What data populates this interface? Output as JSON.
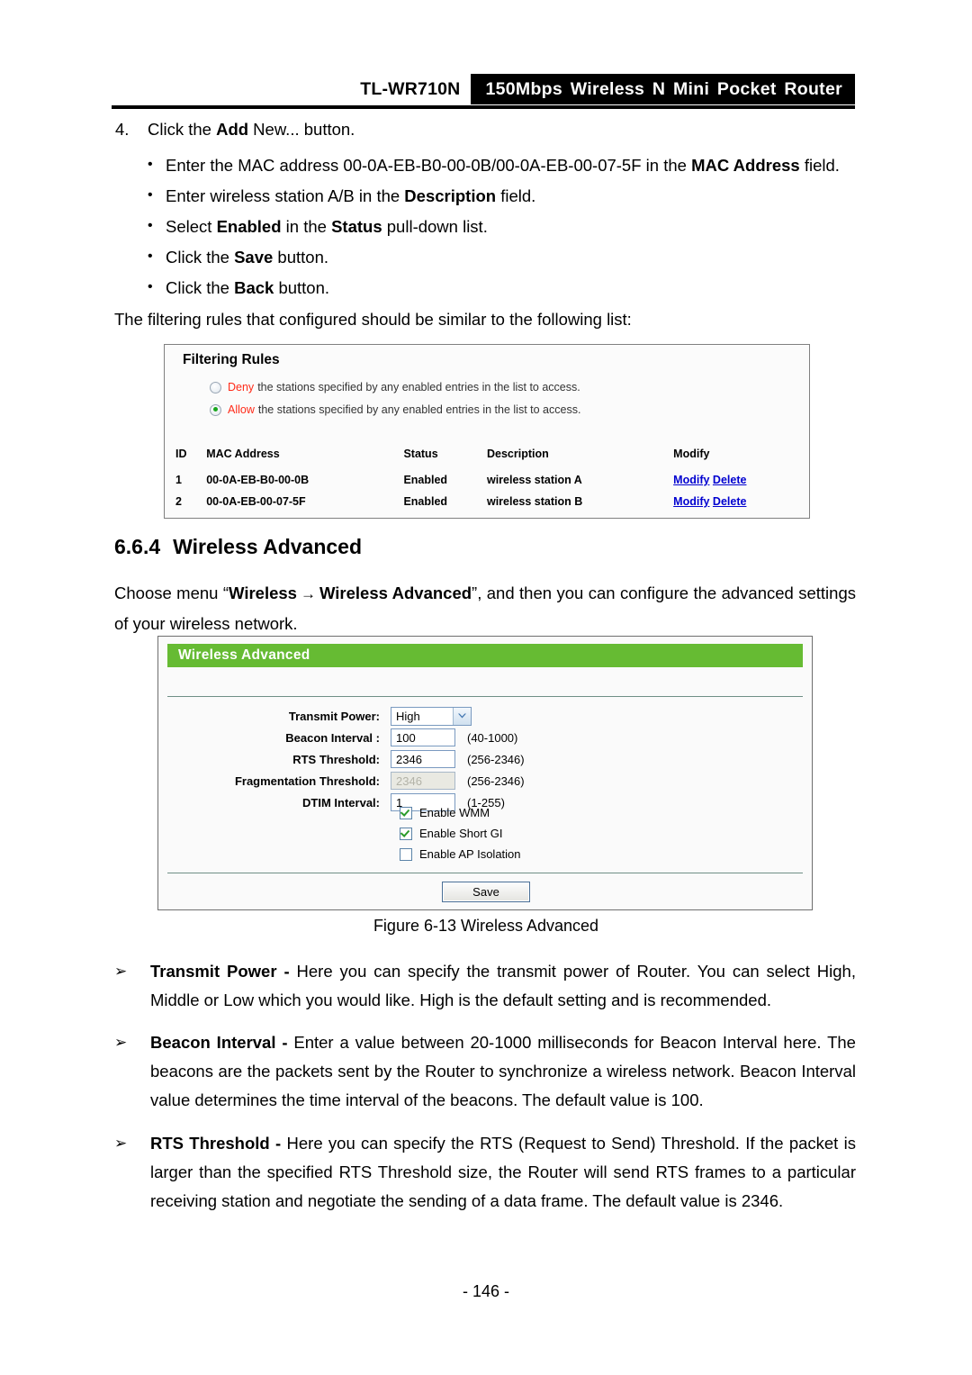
{
  "header": {
    "model": "TL-WR710N",
    "product": "150Mbps Wireless N Mini Pocket Router"
  },
  "step": {
    "number": "4.",
    "text_before": "Click the ",
    "bold1": "Add",
    "text_mid": " New... ",
    "text_after": "button.",
    "full": "4.\tClick the Add New... button."
  },
  "bullets": [
    {
      "pre": "Enter the MAC address ",
      "value": "00-0A-EB-B0-00-0B/00-0A-EB-00-07-5F",
      "mid": " in the ",
      "bold": "MAC Address",
      "post": " field."
    },
    {
      "pre": "Enter wireless station A/B in the ",
      "value": "",
      "mid": "",
      "bold": "Description",
      "post": " field."
    },
    {
      "pre": "Select ",
      "value": "",
      "mid": "",
      "bold": "Enabled",
      "post": " in the ",
      "bold2": "Status",
      "post2": " pull-down list."
    },
    {
      "pre": "Click the ",
      "bold": "Save",
      "post": " button."
    },
    {
      "pre": "Click the ",
      "bold": "Back",
      "post": " button."
    }
  ],
  "intro_paragraph": "The filtering rules that configured should be similar to the following list:",
  "filtering_rules": {
    "title": "Filtering Rules",
    "options": [
      {
        "keyword": "Deny",
        "text": "the stations specified by any enabled entries in the list to access.",
        "selected": false
      },
      {
        "keyword": "Allow",
        "text": "the stations specified by any enabled entries in the list to access.",
        "selected": true
      }
    ],
    "columns": [
      "ID",
      "MAC Address",
      "Status",
      "Description",
      "Modify"
    ],
    "rows": [
      {
        "id": "1",
        "mac": "00-0A-EB-B0-00-0B",
        "status": "Enabled",
        "description": "wireless station A",
        "modify_link": "Modify",
        "delete_link": "Delete"
      },
      {
        "id": "2",
        "mac": "00-0A-EB-00-07-5F",
        "status": "Enabled",
        "description": "wireless station B",
        "modify_link": "Modify",
        "delete_link": "Delete"
      }
    ]
  },
  "section": {
    "number": "6.6.4",
    "title": "Wireless Advanced",
    "choose_pre": "Choose menu “",
    "choose_menu1": "Wireless",
    "choose_arrow": "→",
    "choose_menu2": "Wireless Advanced",
    "choose_post": "”, and then you can configure the advanced settings of your wireless network."
  },
  "wireless_advanced_panel": {
    "panel_title": "Wireless Advanced",
    "accent_color": "#66bb33",
    "fields": [
      {
        "label": "Transmit Power:",
        "type": "select",
        "value": "High",
        "hint": ""
      },
      {
        "label": "Beacon Interval :",
        "type": "text",
        "value": "100",
        "hint": "(40-1000)"
      },
      {
        "label": "RTS Threshold:",
        "type": "text",
        "value": "2346",
        "hint": "(256-2346)"
      },
      {
        "label": "Fragmentation Threshold:",
        "type": "text",
        "value": "2346",
        "hint": "(256-2346)",
        "disabled": true
      },
      {
        "label": "DTIM Interval:",
        "type": "text",
        "value": "1",
        "hint": "(1-255)"
      }
    ],
    "checkboxes": [
      {
        "label": "Enable WMM",
        "checked": true
      },
      {
        "label": "Enable Short GI",
        "checked": true
      },
      {
        "label": "Enable AP Isolation",
        "checked": false
      }
    ],
    "save_label": "Save"
  },
  "figure_caption": "Figure 6-13 Wireless Advanced",
  "definitions": [
    {
      "marker": "➢",
      "term": "Transmit Power",
      "dash": " - ",
      "body": "Here you can specify the transmit power of Router. You can select High, Middle or Low which you would like. High is the default setting and is recommended."
    },
    {
      "marker": "➢",
      "term": "Beacon Interval",
      "dash": " - ",
      "body": "Enter a value between 20-1000 milliseconds for Beacon Interval here. The beacons are the packets sent by the Router to synchronize a wireless network. Beacon Interval value determines the time interval of the beacons. The default value is 100."
    },
    {
      "marker": "➢",
      "term": "RTS Threshold",
      "dash": " - ",
      "body": "Here you can specify the RTS (Request to Send) Threshold. If the packet is larger than the specified RTS Threshold size, the Router will send RTS frames to a particular receiving station and negotiate the sending of a data frame. The default value is 2346."
    }
  ],
  "footer": {
    "page": "- 146 -"
  }
}
